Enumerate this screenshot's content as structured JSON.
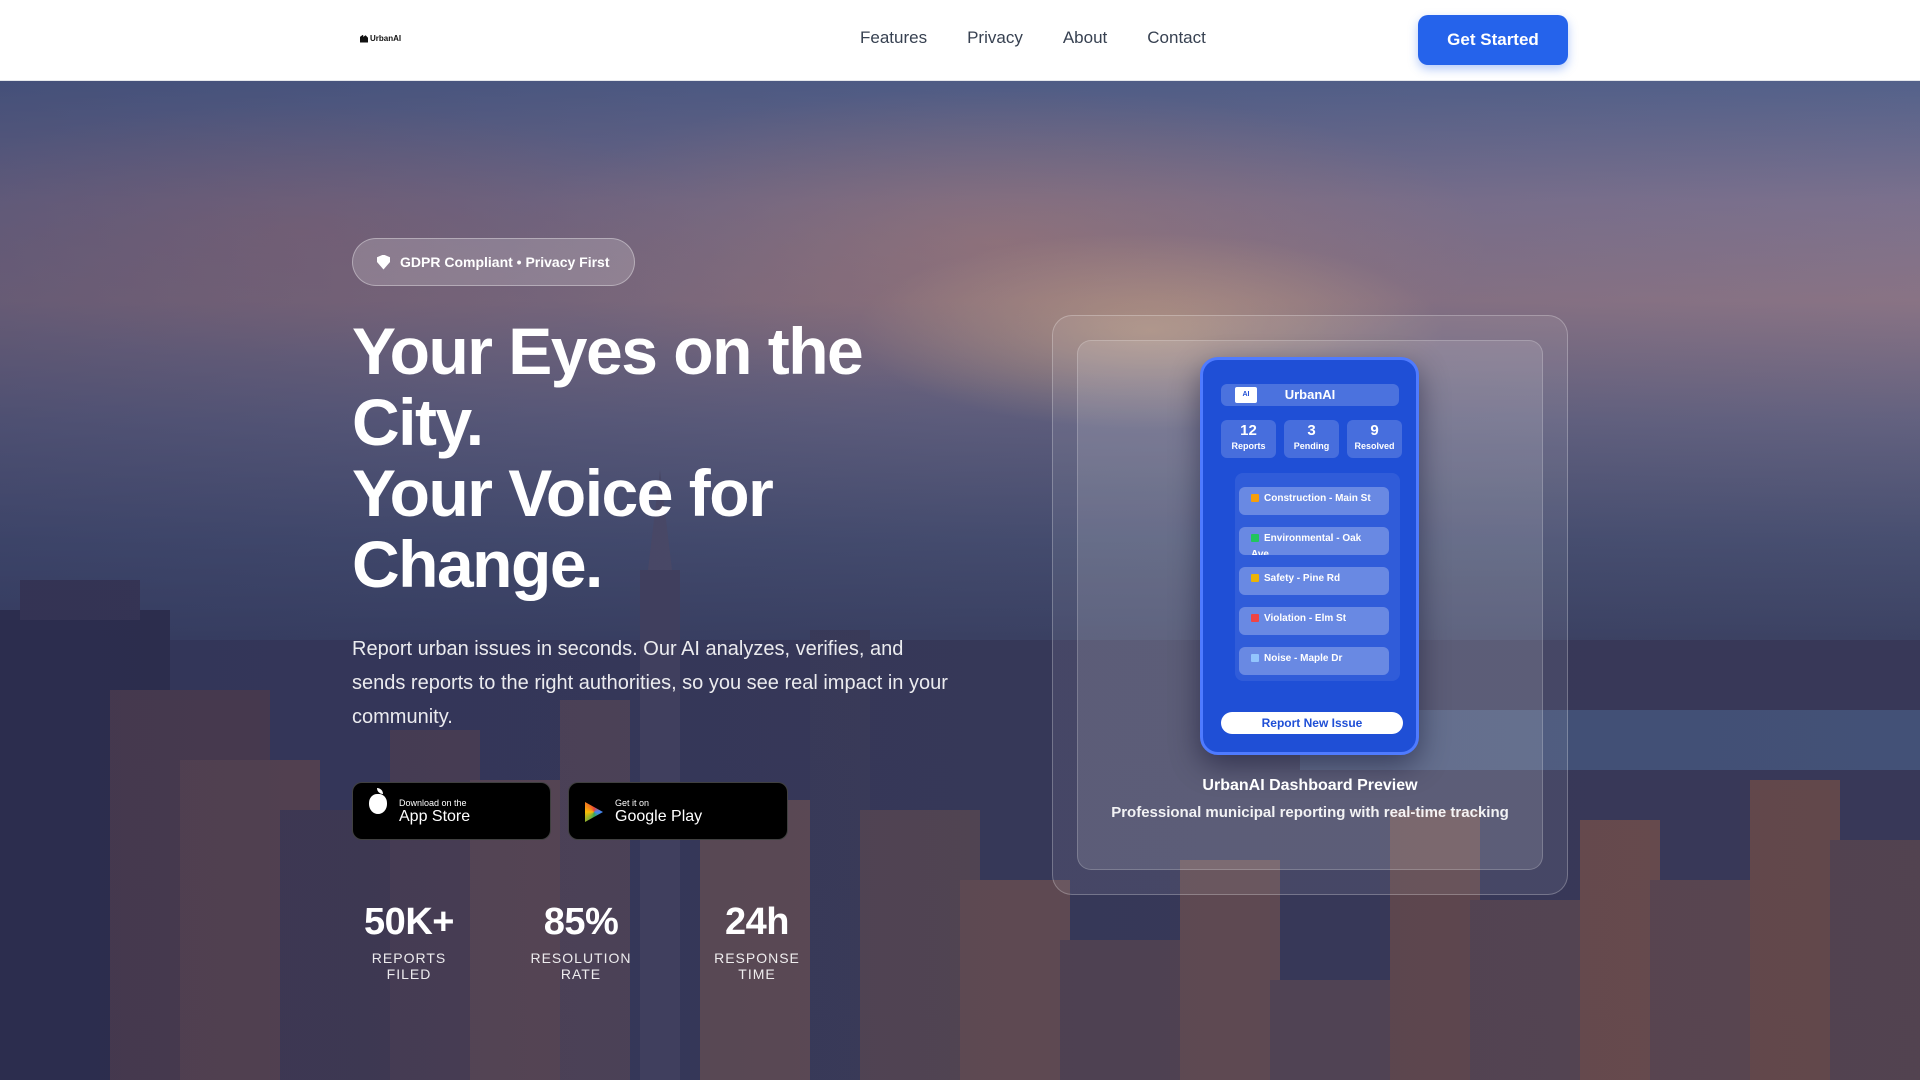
{
  "nav": {
    "logo_text": "UrbanAI",
    "links": [
      "Features",
      "Privacy",
      "About",
      "Contact"
    ],
    "cta_label": "Get Started"
  },
  "hero": {
    "badge": "GDPR Compliant • Privacy First",
    "headline": [
      "Your Eyes on the",
      "City.",
      "Your Voice for",
      "Change."
    ],
    "subtext": "Report urban issues in seconds. Our AI analyzes, verifies, and sends reports to the right authorities, so you see real impact in your community.",
    "app_store": {
      "small": "Download on the",
      "big": "App Store"
    },
    "google_play": {
      "small": "Get it on",
      "big": "Google Play"
    },
    "stats": [
      {
        "value": "50K+",
        "label": "REPORTS FILED"
      },
      {
        "value": "85%",
        "label": "RESOLUTION RATE"
      },
      {
        "value": "24h",
        "label": "RESPONSE TIME"
      }
    ]
  },
  "preview": {
    "phone": {
      "badge": "AI",
      "title": "UrbanAI",
      "stats": [
        {
          "value": "12",
          "label": "Reports"
        },
        {
          "value": "3",
          "label": "Pending"
        },
        {
          "value": "9",
          "label": "Resolved"
        }
      ],
      "items": [
        {
          "label": "Construction - Main St",
          "icon": "construction-icon",
          "color": "#f59e0b"
        },
        {
          "label": "Environmental - Oak Ave",
          "icon": "leaf-icon",
          "color": "#22c55e"
        },
        {
          "label": "Safety - Pine Rd",
          "icon": "safety-stripes-icon",
          "color": "#eab308"
        },
        {
          "label": "Violation - Elm St",
          "icon": "violation-icon",
          "color": "#ef4444"
        },
        {
          "label": "Noise - Maple Dr",
          "icon": "speaker-icon",
          "color": "#93c5fd"
        }
      ],
      "report_button": "Report New Issue"
    },
    "caption_title": "UrbanAI Dashboard Preview",
    "caption_text": "Professional municipal reporting with real-time tracking"
  },
  "colors": {
    "accent": "#2563eb",
    "phone": "#1f4fd6"
  }
}
